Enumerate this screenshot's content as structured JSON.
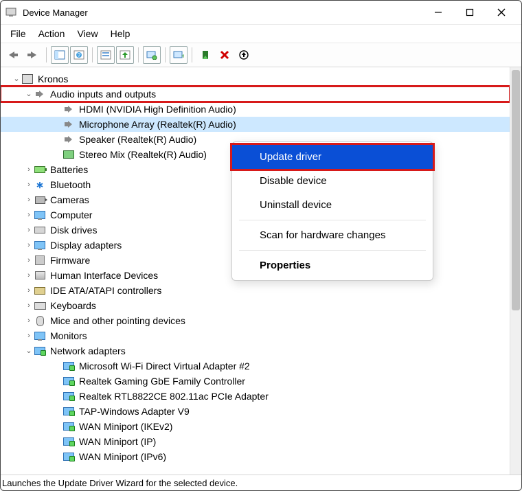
{
  "window": {
    "title": "Device Manager"
  },
  "menubar": [
    "File",
    "Action",
    "View",
    "Help"
  ],
  "tree": {
    "root": "Kronos",
    "nodes": [
      {
        "label": "Audio inputs and outputs",
        "expanded": true,
        "highlight": true,
        "iconClass": "ico-speaker",
        "children": [
          {
            "label": "HDMI (NVIDIA High Definition Audio)",
            "iconClass": "ico-speaker"
          },
          {
            "label": "Microphone Array (Realtek(R) Audio)",
            "iconClass": "ico-speaker",
            "selected": true
          },
          {
            "label": "Speaker (Realtek(R) Audio)",
            "iconClass": "ico-speaker"
          },
          {
            "label": "Stereo Mix (Realtek(R) Audio)",
            "iconClass": "ico-stereo"
          }
        ]
      },
      {
        "label": "Batteries",
        "iconClass": "ico-bat"
      },
      {
        "label": "Bluetooth",
        "iconClass": "ico-bt",
        "iconText": "∗"
      },
      {
        "label": "Cameras",
        "iconClass": "ico-cam"
      },
      {
        "label": "Computer",
        "iconClass": "ico-monitor"
      },
      {
        "label": "Disk drives",
        "iconClass": "ico-disk"
      },
      {
        "label": "Display adapters",
        "iconClass": "ico-monitor"
      },
      {
        "label": "Firmware",
        "iconClass": "ico-firm"
      },
      {
        "label": "Human Interface Devices",
        "iconClass": "ico-hid"
      },
      {
        "label": "IDE ATA/ATAPI controllers",
        "iconClass": "ico-ide"
      },
      {
        "label": "Keyboards",
        "iconClass": "ico-kb"
      },
      {
        "label": "Mice and other pointing devices",
        "iconClass": "ico-mouse"
      },
      {
        "label": "Monitors",
        "iconClass": "ico-monitor"
      },
      {
        "label": "Network adapters",
        "expanded": true,
        "iconClass": "ico-net",
        "children": [
          {
            "label": "Microsoft Wi-Fi Direct Virtual Adapter #2",
            "iconClass": "ico-net"
          },
          {
            "label": "Realtek Gaming GbE Family Controller",
            "iconClass": "ico-net"
          },
          {
            "label": "Realtek RTL8822CE 802.11ac PCIe Adapter",
            "iconClass": "ico-net"
          },
          {
            "label": "TAP-Windows Adapter V9",
            "iconClass": "ico-net"
          },
          {
            "label": "WAN Miniport (IKEv2)",
            "iconClass": "ico-net"
          },
          {
            "label": "WAN Miniport (IP)",
            "iconClass": "ico-net"
          },
          {
            "label": "WAN Miniport (IPv6)",
            "iconClass": "ico-net"
          }
        ]
      }
    ]
  },
  "context_menu": {
    "items": [
      {
        "label": "Update driver",
        "highlighted": true
      },
      {
        "label": "Disable device"
      },
      {
        "label": "Uninstall device"
      },
      {
        "separator": true
      },
      {
        "label": "Scan for hardware changes"
      },
      {
        "separator": true
      },
      {
        "label": "Properties",
        "bold": true
      }
    ]
  },
  "statusbar": "Launches the Update Driver Wizard for the selected device."
}
